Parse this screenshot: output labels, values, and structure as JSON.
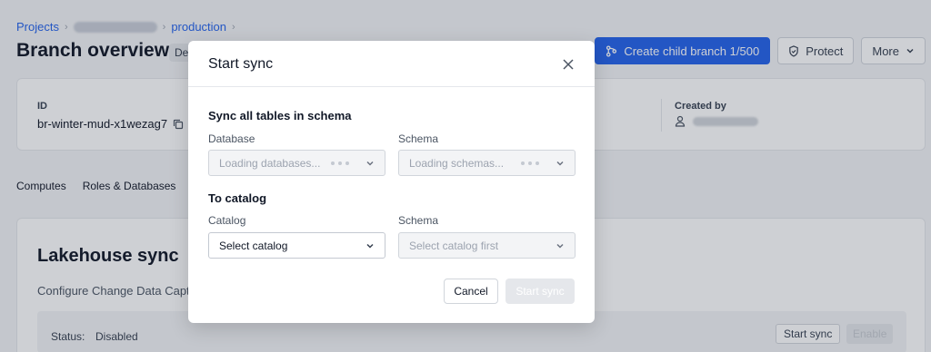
{
  "breadcrumb": {
    "items": [
      "Projects",
      "production"
    ],
    "separator": "›"
  },
  "page": {
    "title": "Branch overview",
    "title_badge": "De"
  },
  "header_actions": {
    "create_child_label": "Create child branch 1/500",
    "protect_label": "Protect",
    "more_label": "More"
  },
  "info": {
    "id_label": "ID",
    "id_value": "br-winter-mud-x1wezag7",
    "created_by_label": "Created by"
  },
  "tabs": [
    "Computes",
    "Roles & Databases"
  ],
  "lakehouse": {
    "title": "Lakehouse sync",
    "description": "Configure Change Data Capt",
    "status_label": "Status:",
    "status_value": "Disabled",
    "start_sync_label": "Start sync",
    "enable_label": "Enable"
  },
  "modal": {
    "title": "Start sync",
    "section_source": "Sync all tables in schema",
    "database_label": "Database",
    "database_placeholder": "Loading databases...",
    "schema_label": "Schema",
    "schema_placeholder": "Loading schemas...",
    "section_target": "To catalog",
    "catalog_label": "Catalog",
    "catalog_placeholder": "Select catalog",
    "target_schema_label": "Schema",
    "target_schema_placeholder": "Select catalog first",
    "cancel_label": "Cancel",
    "submit_label": "Start sync"
  },
  "colors": {
    "accent": "#2563eb",
    "overlay": "rgba(30,41,59,0.22)"
  },
  "icons": [
    "chevron-right-icon",
    "branch-icon",
    "shield-icon",
    "chevron-down-icon",
    "copy-icon",
    "user-icon",
    "close-icon"
  ]
}
